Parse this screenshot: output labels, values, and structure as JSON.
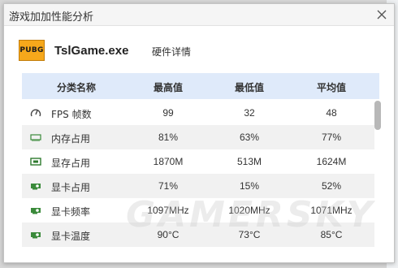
{
  "window": {
    "title": "游戏加加性能分析"
  },
  "app": {
    "logo_text": "PUBG",
    "name": "TslGame.exe",
    "subtitle": "硬件详情"
  },
  "table": {
    "columns": [
      "分类名称",
      "最高值",
      "最低值",
      "平均值"
    ],
    "rows": [
      {
        "icon": "gauge-icon",
        "name": "FPS 帧数",
        "max": "99",
        "min": "32",
        "avg": "48"
      },
      {
        "icon": "memory-icon",
        "name": "内存占用",
        "max": "81%",
        "min": "63%",
        "avg": "77%"
      },
      {
        "icon": "vram-icon",
        "name": "显存占用",
        "max": "1870M",
        "min": "513M",
        "avg": "1624M"
      },
      {
        "icon": "gpu-card-icon",
        "name": "显卡占用",
        "max": "71%",
        "min": "15%",
        "avg": "52%"
      },
      {
        "icon": "gpu-card-icon",
        "name": "显卡频率",
        "max": "1097MHz",
        "min": "1020MHz",
        "avg": "1071MHz"
      },
      {
        "icon": "gpu-card-icon",
        "name": "显卡温度",
        "max": "90°C",
        "min": "73°C",
        "avg": "85°C"
      }
    ]
  },
  "watermark": "GAMERSKY",
  "colors": {
    "header_bg": "#dfeafa",
    "alt_row_bg": "#f1f1f1",
    "icon_green": "#3a8a3a",
    "logo_bg": "#f6a81b"
  }
}
